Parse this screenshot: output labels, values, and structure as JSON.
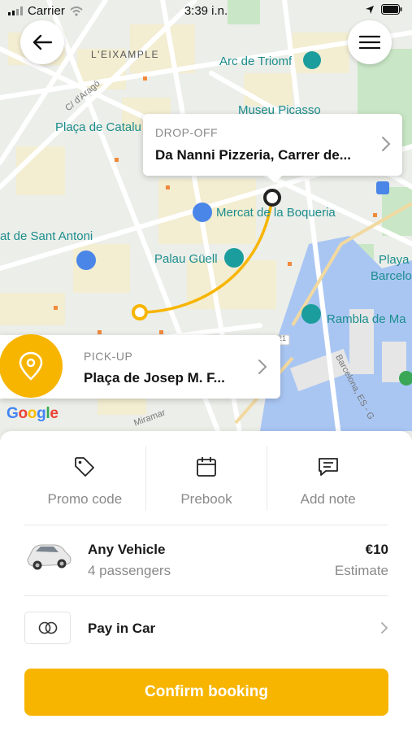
{
  "status_bar": {
    "carrier": "Carrier",
    "time": "3:39 i.n."
  },
  "map": {
    "labels": {
      "eixample": "L'EIXAMPLE",
      "arc_de_triomf": "Arc de Triomf",
      "museu_picasso": "Museu Picasso",
      "placa_catalunya": "Plaça de Catalu",
      "carrer_arago": "C/ d'Aragó",
      "mercat_boqueria": "Mercat de la Boqueria",
      "sant_antoni": "at de Sant Antoni",
      "palau_guell": "Palau Güell",
      "playa": "Playa",
      "barcelo": "Barcelo",
      "rambla_de_mar": "Rambla de Ma",
      "barcelona_road": "Barcelona, ES - G",
      "miramar": "Miramar",
      "road_21": "21"
    },
    "google_logo": "Google",
    "colors": {
      "route": "#f7b500",
      "water": "#a7c5f5",
      "park": "#c7e6c5",
      "road": "#ffffff",
      "block": "#f3ecd0"
    }
  },
  "dropoff": {
    "caption": "DROP-OFF",
    "value": "Da Nanni Pizzeria, Carrer de..."
  },
  "pickup": {
    "caption": "PICK-UP",
    "value": "Plaça de Josep M. F..."
  },
  "actions": [
    {
      "label": "Promo code",
      "icon": "tag-icon"
    },
    {
      "label": "Prebook",
      "icon": "calendar-icon"
    },
    {
      "label": "Add note",
      "icon": "note-icon"
    }
  ],
  "vehicle": {
    "name": "Any Vehicle",
    "passengers": "4 passengers",
    "price": "€10",
    "price_note": "Estimate"
  },
  "payment": {
    "label": "Pay in Car"
  },
  "confirm": {
    "label": "Confirm booking"
  },
  "colors": {
    "accent": "#f7b500",
    "muted_text": "#8a8a8a"
  }
}
